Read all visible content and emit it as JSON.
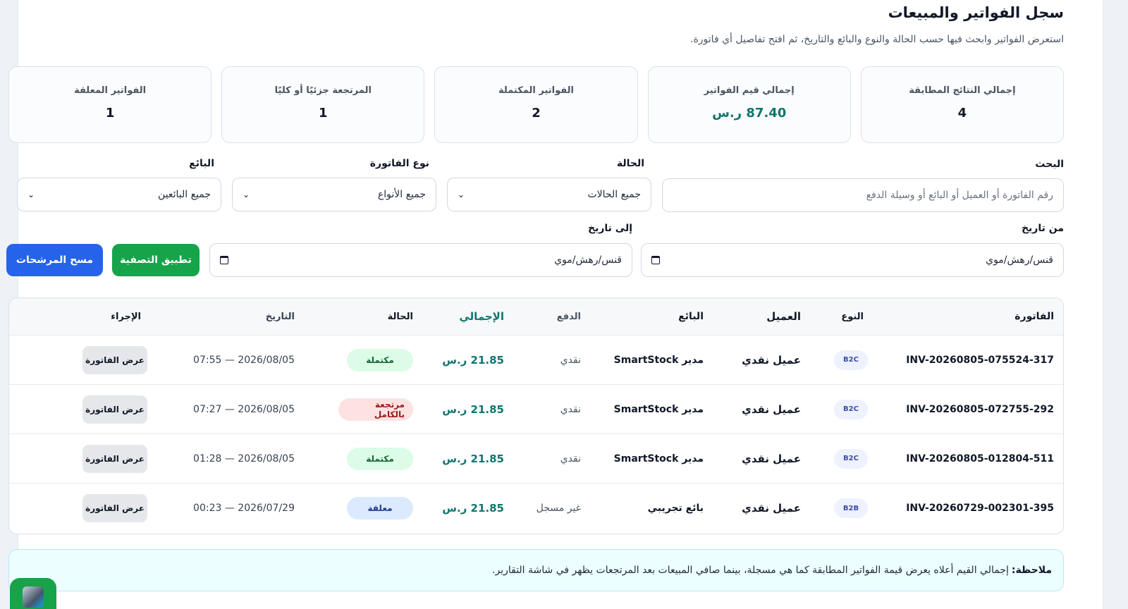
{
  "header": {
    "title": "سجل الفواتير والمبيعات",
    "subtitle": "استعرض الفواتير وابحث فيها حسب الحالة والنوع والبائع والتاريخ، ثم افتح تفاصيل أي فاتورة."
  },
  "stats": [
    {
      "label": "إجمالي النتائج المطابقة",
      "value": "4"
    },
    {
      "label": "إجمالي قيم الفواتير",
      "value": "87.40 ر.س"
    },
    {
      "label": "الفواتير المكتملة",
      "value": "2"
    },
    {
      "label": "المرتجعة جزئيًا أو كليًا",
      "value": "1"
    },
    {
      "label": "الفواتير المعلقة",
      "value": "1"
    }
  ],
  "filters": {
    "search_label": "البحث",
    "search_placeholder": "رقم الفاتورة أو العميل أو البائع أو وسيلة الدفع",
    "status_label": "الحالة",
    "status_value": "جميع الحالات",
    "type_label": "نوع الفاتورة",
    "type_value": "جميع الأنواع",
    "seller_label": "البائع",
    "seller_value": "جميع البائعين",
    "from_label": "من تاريخ",
    "from_value": "قنس/رهش/موي",
    "to_label": "إلى تاريخ",
    "to_value": "قنس/رهش/موي",
    "apply_label": "تطبيق التصفية",
    "clear_label": "مسح المرشحات"
  },
  "table": {
    "headers": {
      "invoice": "الفاتورة",
      "type": "النوع",
      "customer": "العميل",
      "seller": "البائع",
      "payment": "الدفع",
      "total": "الإجمالي",
      "status": "الحالة",
      "date": "التاريخ",
      "action": "الإجراء"
    },
    "rows": [
      {
        "invoice": "INV-20260805-075524-317",
        "type": "B2C",
        "customer": "عميل نقدي",
        "seller": "مدير SmartStock",
        "payment": "نقدي",
        "total": "21.85 ر.س",
        "status": "مكتملة",
        "date": "2026/08/05 — 07:55",
        "action": "عرض الفاتورة"
      },
      {
        "invoice": "INV-20260805-072755-292",
        "type": "B2C",
        "customer": "عميل نقدي",
        "seller": "مدير SmartStock",
        "payment": "نقدي",
        "total": "21.85 ر.س",
        "status": "مرتجعة بالكامل",
        "date": "2026/08/05 — 07:27",
        "action": "عرض الفاتورة"
      },
      {
        "invoice": "INV-20260805-012804-511",
        "type": "B2C",
        "customer": "عميل نقدي",
        "seller": "مدير SmartStock",
        "payment": "نقدي",
        "total": "21.85 ر.س",
        "status": "مكتملة",
        "date": "2026/08/05 — 01:28",
        "action": "عرض الفاتورة"
      },
      {
        "invoice": "INV-20260729-002301-395",
        "type": "B2B",
        "customer": "عميل نقدي",
        "seller": "بائع تجريبي",
        "payment": "غير مسجل",
        "total": "21.85 ر.س",
        "status": "معلقة",
        "date": "2026/07/29 — 00:23",
        "action": "عرض الفاتورة"
      }
    ]
  },
  "note": {
    "title": "ملاحظة:",
    "text": "إجمالي القيم أعلاه يعرض قيمة الفواتير المطابقة كما هي مسجلة، بينما صافي المبيعات بعد المرتجعات يظهر في شاشة التقارير."
  },
  "colors": {
    "accent_green": "#16a34a",
    "accent_blue": "#2563eb",
    "money": "#0f766e"
  }
}
